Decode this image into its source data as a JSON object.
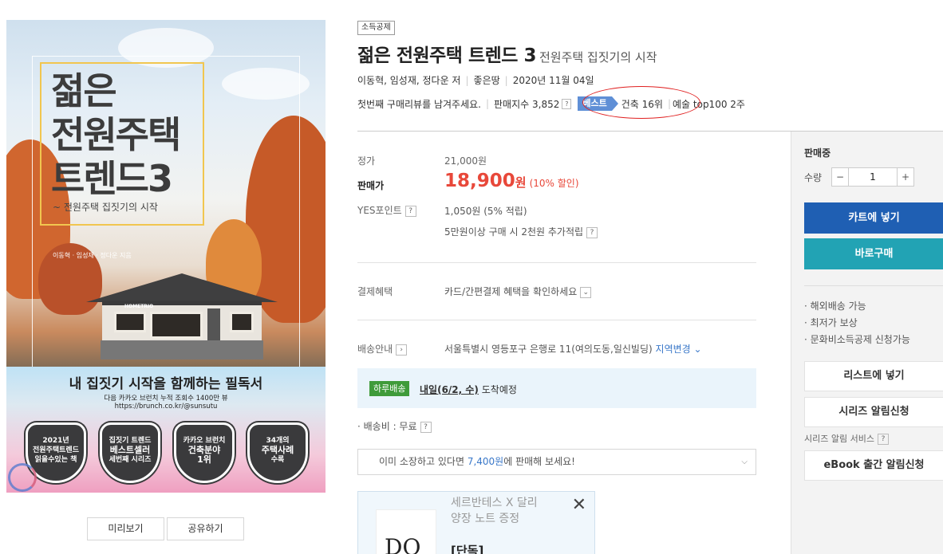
{
  "cover": {
    "title_line1": "젊은",
    "title_line2": "전원주택",
    "title_line3": "트렌드3",
    "subtitle": "~ 전원주택 집짓기의 시작",
    "authors": "이동혁 · 임성재 · 정다운 지음",
    "brand": "HOMETRIO",
    "banner_head": "내 집짓기 시작을 함께하는 필독서",
    "banner_line1": "다음 카카오 브런치 누적 조회수 1400만 뷰",
    "banner_line2": "https://brunch.co.kr/@sunsutu",
    "badges": [
      {
        "l1": "2021년",
        "l2": "전원주택트렌드",
        "l3": "읽을수있는 책"
      },
      {
        "l1": "집짓기 트렌드",
        "l2": "베스트셀러",
        "l3": "세번째 시리즈"
      },
      {
        "l1": "카카오 브런치",
        "l2": "건축분야",
        "l3": "1위"
      },
      {
        "l1": "34개의",
        "l2": "주택사례",
        "l3": "수록"
      }
    ]
  },
  "cover_buttons": {
    "preview": "미리보기",
    "share": "공유하기"
  },
  "header": {
    "category_badge": "소득공제",
    "title": "젊은 전원주택 트렌드 3",
    "subtitle": "전원주택 집짓기의 시작",
    "authors": "이동혁, 임성재, 정다운 저",
    "publisher": "좋은땅",
    "pub_date": "2020년 11월 04일",
    "review_prompt": "첫번째 구매리뷰를 남겨주세요.",
    "sales_index": "판매지수 3,852",
    "best_tag": "베스트",
    "best_rank": "건축 16위",
    "best_rank2": "예술 top100 2주"
  },
  "price": {
    "list_label": "정가",
    "list_value": "21,000원",
    "sale_label": "판매가",
    "sale_num": "18,900",
    "sale_won": "원",
    "sale_discount": "(10% 할인)",
    "point_label": "YES포인트",
    "point_value": "1,050원 (5% 적립)",
    "point_extra": "5만원이상 구매 시 2천원 추가적립",
    "benefit_label": "결제혜택",
    "benefit_value": "카드/간편결제 혜택을 확인하세요",
    "ship_label": "배송안내",
    "ship_address": "서울특별시 영등포구 은행로 11(여의도동,일신빌딩)",
    "ship_change": "지역변경",
    "day_tag": "하루배송",
    "arrival_date": "내일(6/2, 수)",
    "arrival_suffix": "도착예정",
    "ship_fee": "· 배송비 : 무료",
    "sell_prefix": "이미 소장하고 있다면",
    "sell_amount": "7,400원",
    "sell_suffix": "에 판매해 보세요!"
  },
  "promo": {
    "line1": "세르반테스 X 달리",
    "line2": "양장 노트 증정",
    "strong": "[단독]",
    "thumb_text": "DQ"
  },
  "side": {
    "status": "판매중",
    "qty_label": "수량",
    "qty_minus": "−",
    "qty_value": "1",
    "qty_plus": "+",
    "cart_label": "카트에 넣기",
    "buy_label": "바로구매",
    "bullets": [
      "해외배송 가능",
      "최저가 보상",
      "문화비소득공제 신청가능"
    ],
    "list_label": "리스트에 넣기",
    "series_label": "시리즈 알림신청",
    "series_note": "시리즈 알림 서비스",
    "ebook_label": "eBook 출간 알림신청"
  },
  "colors": {
    "sale_red": "#e8483a",
    "cart_blue": "#1f5fb3",
    "buy_teal": "#22a3b4",
    "best_blue": "#5f8fd6",
    "day_green": "#3f9b3a",
    "annotation_red": "#e02020"
  }
}
